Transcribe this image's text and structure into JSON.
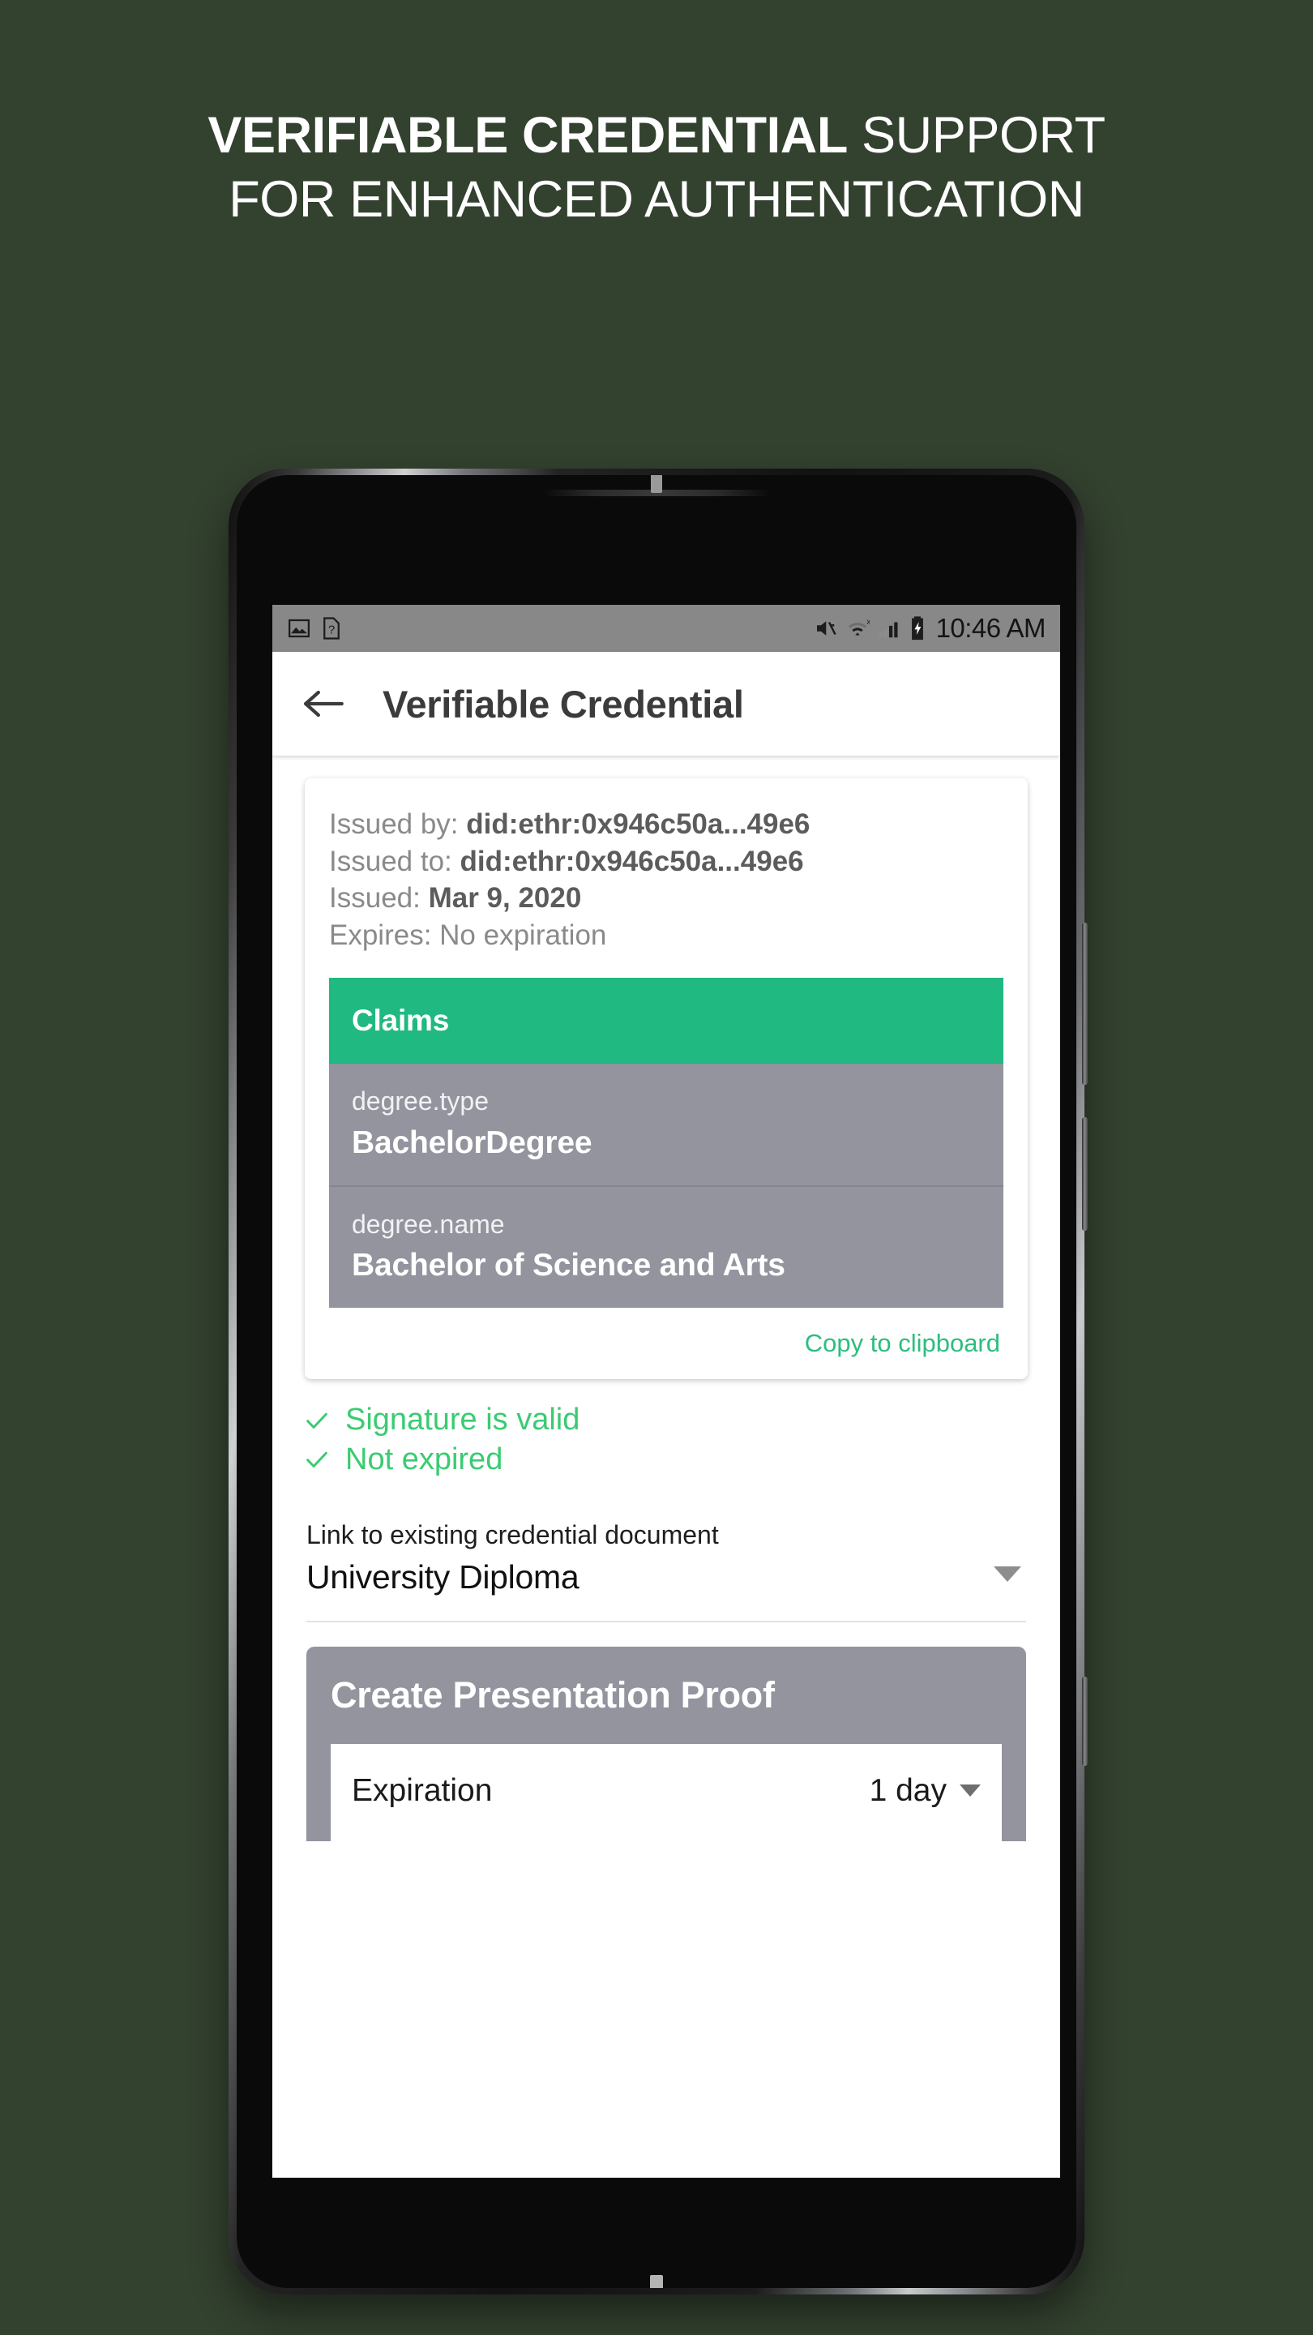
{
  "headline": {
    "line1_bold": "VERIFIABLE CREDENTIAL",
    "line1_rest": " SUPPORT",
    "line2": "FOR ENHANCED AUTHENTICATION"
  },
  "statusbar": {
    "icons_left": [
      "image-icon",
      "sim-card-icon"
    ],
    "icons_right": [
      "mute-icon",
      "wifi-icon",
      "cell-signal-icon",
      "battery-charging-icon"
    ],
    "time": "10:46 AM"
  },
  "appbar": {
    "back_icon": "back-arrow-icon",
    "title": "Verifiable Credential"
  },
  "credential": {
    "issued_by_label": "Issued by: ",
    "issued_by_value": "did:ethr:0x946c50a...49e6",
    "issued_to_label": "Issued to: ",
    "issued_to_value": "did:ethr:0x946c50a...49e6",
    "issued_label": "Issued: ",
    "issued_value": "Mar 9, 2020",
    "expires_label": "Expires: ",
    "expires_value": "No expiration",
    "claims_header": "Claims",
    "claims": [
      {
        "key": "degree.type",
        "value": "BachelorDegree"
      },
      {
        "key": "degree.name",
        "value": "Bachelor of Science and Arts"
      }
    ],
    "copy_link": "Copy to clipboard"
  },
  "validation": [
    {
      "icon": "check-icon",
      "label": "Signature is valid"
    },
    {
      "icon": "check-icon",
      "label": "Not expired"
    }
  ],
  "document_link": {
    "label": "Link to existing credential document",
    "value": "University Diploma",
    "caret": "chevron-down-icon"
  },
  "proof": {
    "title": "Create Presentation Proof",
    "expiration_label": "Expiration",
    "expiration_value": "1 day",
    "caret": "chevron-down-icon"
  },
  "colors": {
    "background": "#33412f",
    "accent_green": "#20b981",
    "valid_green": "#3bcb72",
    "link_green": "#2cbe7f",
    "claims_gray": "#93949e",
    "statusbar_gray": "#888888"
  }
}
